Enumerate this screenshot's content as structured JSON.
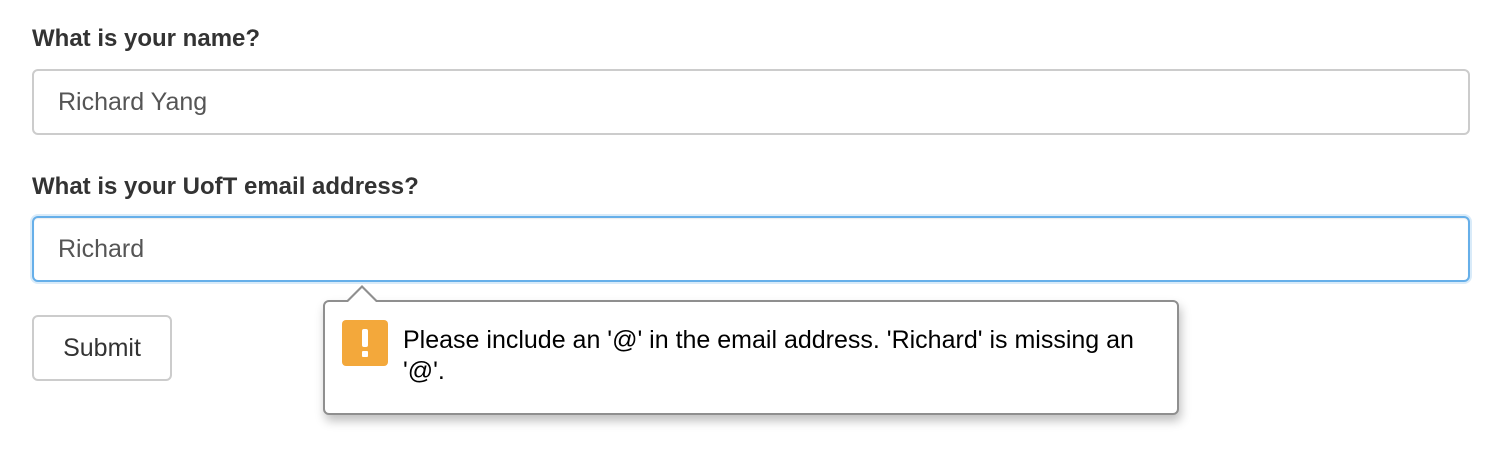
{
  "form": {
    "name_label": "What is your name?",
    "name_value": "Richard Yang",
    "email_label": "What is your UofT email address?",
    "email_value": "Richard",
    "submit_label": "Submit"
  },
  "validation_tooltip": {
    "icon": "warning-icon",
    "icon_color": "#f3a83b",
    "message": "Please include an '@' in the email address. 'Richard' is missing an '@'."
  },
  "colors": {
    "focus_border": "#66afe9",
    "input_border": "#cccccc",
    "label_text": "#333333"
  }
}
